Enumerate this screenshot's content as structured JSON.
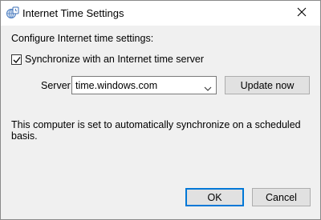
{
  "window": {
    "title": "Internet Time Settings",
    "close_icon": "close-icon",
    "app_icon": "internet-time-icon"
  },
  "main": {
    "heading": "Configure Internet time settings:",
    "sync_checkbox": {
      "label": "Synchronize with an Internet time server",
      "checked": true
    },
    "server": {
      "label": "Server:",
      "value": "time.windows.com"
    },
    "update_button": "Update now",
    "status_text": "This computer is set to automatically synchronize on a scheduled basis."
  },
  "footer": {
    "ok_label": "OK",
    "cancel_label": "Cancel"
  },
  "colors": {
    "dialog_bg": "#f0f0f0",
    "titlebar_bg": "#ffffff",
    "button_bg": "#e1e1e1",
    "default_button_border": "#0078d7"
  }
}
